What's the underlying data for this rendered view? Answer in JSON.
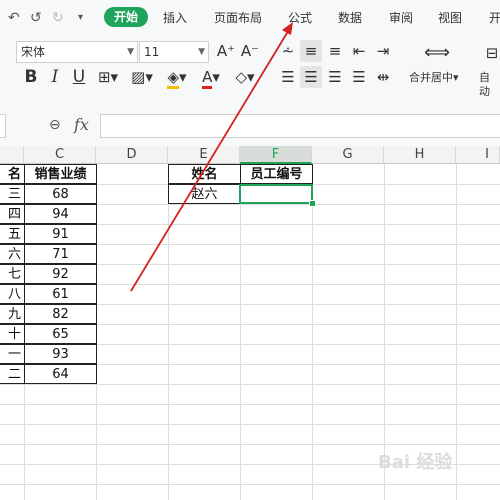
{
  "ribbon": {
    "tabs": [
      "开始",
      "插入",
      "页面布局",
      "公式",
      "数据",
      "审阅",
      "视图",
      "开"
    ],
    "active_tab": "开始",
    "accent_color": "#1fa55b"
  },
  "toolbar": {
    "font_name": "宋体",
    "font_size": "11",
    "merge_center_label": "合并居中",
    "auto_wrap_label": "自动",
    "grow_font": "A⁺",
    "shrink_font": "A⁻",
    "bold": "B",
    "italic": "I",
    "underline": "U",
    "font_color_glyph": "A"
  },
  "formula_bar": {
    "fx_label": "fx",
    "value": ""
  },
  "columns": [
    "C",
    "D",
    "E",
    "F",
    "G",
    "H",
    "I"
  ],
  "active_column": "F",
  "table_left": {
    "header_clipped": "名",
    "header": "销售业绩",
    "clipped_names": [
      "三",
      "四",
      "五",
      "六",
      "七",
      "八",
      "九",
      "十",
      "一",
      "二"
    ],
    "values": [
      "68",
      "94",
      "91",
      "71",
      "92",
      "61",
      "82",
      "65",
      "93",
      "64"
    ]
  },
  "table_right": {
    "header_name": "姓名",
    "header_id": "员工编号",
    "name": "赵六",
    "id": ""
  },
  "watermark": "Bai 经验"
}
